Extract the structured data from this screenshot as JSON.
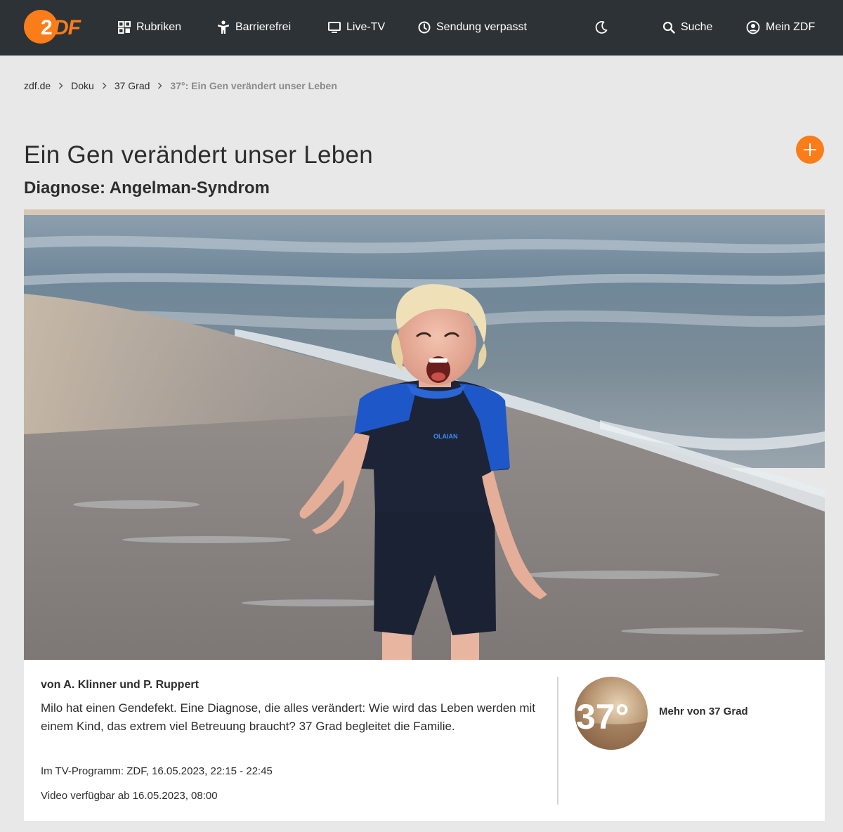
{
  "header": {
    "logo_text": "2DF",
    "nav": {
      "rubriken": "Rubriken",
      "barrierefrei": "Barrierefrei",
      "livetv": "Live-TV",
      "verpasst": "Sendung verpasst",
      "suche": "Suche",
      "meinzdf": "Mein ZDF"
    }
  },
  "breadcrumb": [
    "zdf.de",
    "Doku",
    "37 Grad",
    "37°: Ein Gen verändert unser Leben"
  ],
  "main": {
    "title": "Ein Gen verändert unser Leben",
    "subtitle": "Diagnose: Angelman-Syndrom"
  },
  "hero": {
    "shirt_brand": "OLAIAN"
  },
  "info": {
    "authors": "von A. Klinner und P. Ruppert",
    "description": "Milo hat einen Gendefekt. Eine Diagnose, die alles verändert: Wie wird das Leben werden mit einem Kind, das extrem viel Betreuung braucht? 37 Grad begleitet die Familie.",
    "tv_program": "Im TV-Programm: ZDF, 16.05.2023, 22:15 - 22:45",
    "availability": "Video verfügbar ab 16.05.2023, 08:00",
    "more_label": "Mehr von 37 Grad",
    "brand_logo_text": "37°"
  },
  "colors": {
    "nav_bg": "#2d3236",
    "accent": "#fa7d19",
    "page_bg": "#e8e8e8",
    "card_bg": "#ffffff"
  },
  "icons": {
    "rubriken": "grid-icon",
    "barrierefrei": "accessibility-icon",
    "livetv": "monitor-icon",
    "verpasst": "clock-icon",
    "darkmode": "moon-icon",
    "suche": "search-icon",
    "meinzdf": "user-circle-icon",
    "add": "plus-icon"
  }
}
